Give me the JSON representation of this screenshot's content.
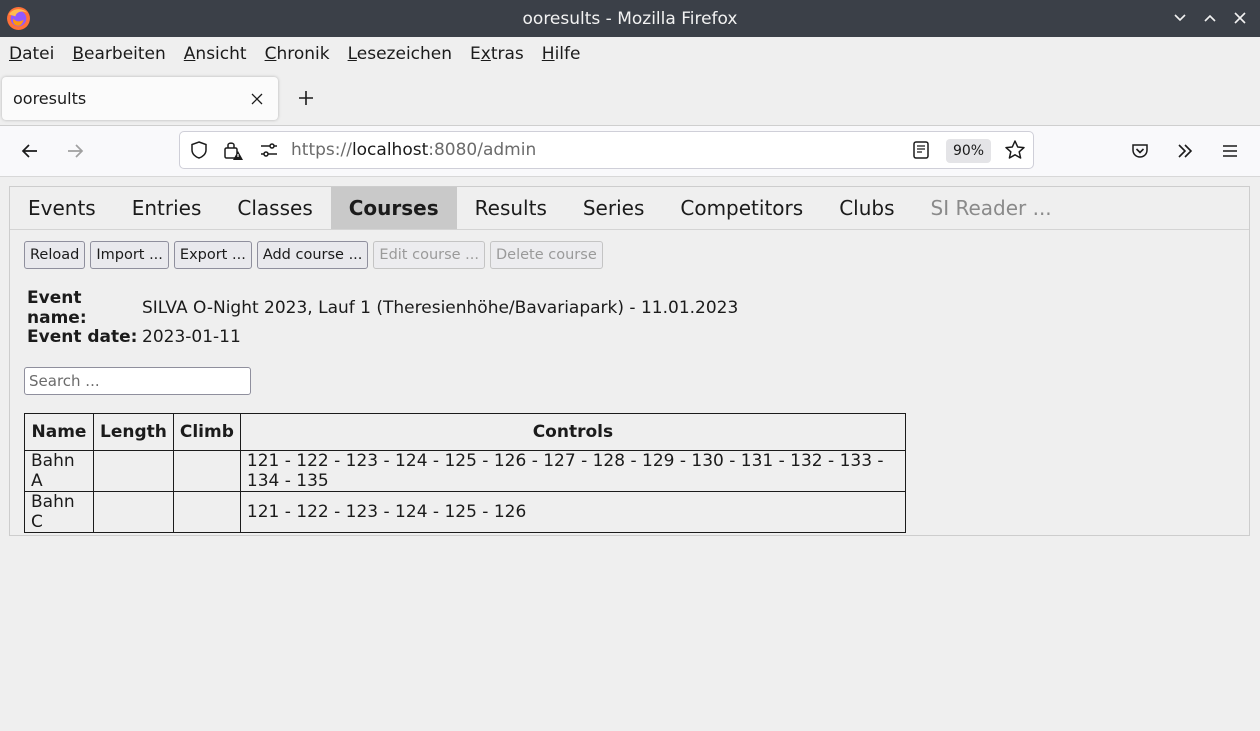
{
  "window": {
    "title": "ooresults - Mozilla Firefox"
  },
  "menu": {
    "items": [
      {
        "first": "D",
        "rest": "atei"
      },
      {
        "first": "B",
        "rest": "earbeiten"
      },
      {
        "first": "A",
        "rest": "nsicht"
      },
      {
        "first": "C",
        "rest": "hronik"
      },
      {
        "first": "L",
        "rest": "esezeichen"
      },
      {
        "pre": "E",
        "first": "x",
        "rest": "tras"
      },
      {
        "first": "H",
        "rest": "ilfe"
      }
    ]
  },
  "browser": {
    "tab_title": "ooresults",
    "url_scheme": "https://",
    "url_host": "localhost",
    "url_rest": ":8080/admin",
    "zoom": "90%"
  },
  "app": {
    "tabs": [
      "Events",
      "Entries",
      "Classes",
      "Courses",
      "Results",
      "Series",
      "Competitors",
      "Clubs",
      "SI Reader ..."
    ],
    "active_tab": "Courses",
    "toolbar": {
      "reload": "Reload",
      "import": "Import ...",
      "export": "Export ...",
      "add": "Add course ...",
      "edit": "Edit course ...",
      "delete": "Delete course"
    },
    "event": {
      "name_label": "Event name:",
      "name_value": "SILVA O-Night 2023, Lauf 1 (Theresienhöhe/Bavariapark) - 11.01.2023",
      "date_label": "Event date:",
      "date_value": "2023-01-11"
    },
    "search_placeholder": "Search ...",
    "table": {
      "headers": [
        "Name",
        "Length",
        "Climb",
        "Controls"
      ],
      "rows": [
        {
          "name": "Bahn A",
          "length": "",
          "climb": "",
          "controls": "121 - 122 - 123 - 124 - 125 - 126 - 127 - 128 - 129 - 130 - 131 - 132 - 133 - 134 - 135"
        },
        {
          "name": "Bahn C",
          "length": "",
          "climb": "",
          "controls": "121 - 122 - 123 - 124 - 125 - 126"
        }
      ]
    }
  }
}
